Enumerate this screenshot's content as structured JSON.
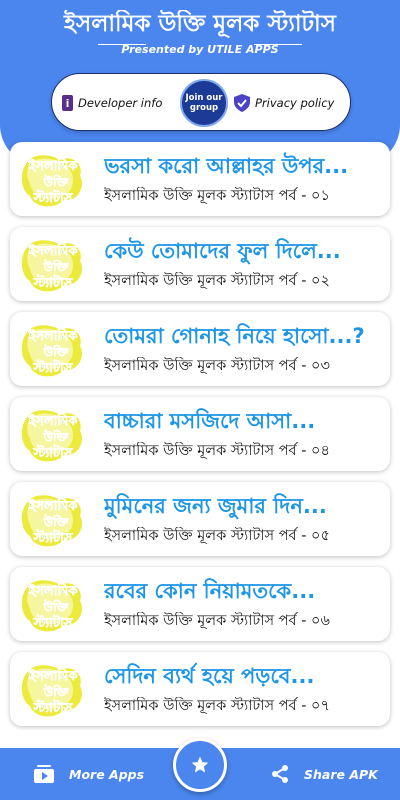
{
  "header": {
    "title": "ইসলামিক উক্তি মূলক স্ট্যাটাস",
    "presented_by": "Presented by UTILE APPS",
    "actions": {
      "developer_info": "Developer info",
      "join_group": "Join our group",
      "privacy_policy": "Privacy policy"
    }
  },
  "thumbnail": {
    "line1": "ইসলামিক",
    "line2": "উক্তি",
    "line3": "স্ট্যাটাস"
  },
  "items": [
    {
      "title": "ভরসা করো আল্লাহর উপর...",
      "subtitle": "ইসলামিক উক্তি মূলক স্ট্যাটাস পর্ব - ০১"
    },
    {
      "title": "কেউ তোমাদের ফুল দিলে...",
      "subtitle": "ইসলামিক উক্তি মূলক স্ট্যাটাস পর্ব - ০২"
    },
    {
      "title": "তোমরা গোনাহ নিয়ে হাসো...?",
      "subtitle": "ইসলামিক উক্তি মূলক স্ট্যাটাস পর্ব - ০৩"
    },
    {
      "title": "বাচ্চারা মসজিদে আসা...",
      "subtitle": "ইসলামিক উক্তি মূলক স্ট্যাটাস পর্ব - ০৪"
    },
    {
      "title": "মুমিনের জন্য জুমার দিন...",
      "subtitle": "ইসলামিক উক্তি মূলক স্ট্যাটাস পর্ব - ০৫"
    },
    {
      "title": "রবের কোন নিয়ামতকে...",
      "subtitle": "ইসলামিক উক্তি মূলক স্ট্যাটাস পর্ব - ০৬"
    },
    {
      "title": "সেদিন ব্যর্থ হয়ে পড়বে...",
      "subtitle": "ইসলামিক উক্তি মূলক স্ট্যাটাস পর্ব - ০৭"
    }
  ],
  "bottom_bar": {
    "more_apps": "More Apps",
    "share_apk": "Share APK"
  },
  "icons": {
    "developer": "info-icon",
    "privacy": "shield-check-icon",
    "more_apps": "app-store-icon",
    "share": "share-icon",
    "fab": "star-icon"
  },
  "colors": {
    "primary": "#4a86ee",
    "title_blue": "#1e96e6",
    "thumb_green": "#2db34a"
  }
}
